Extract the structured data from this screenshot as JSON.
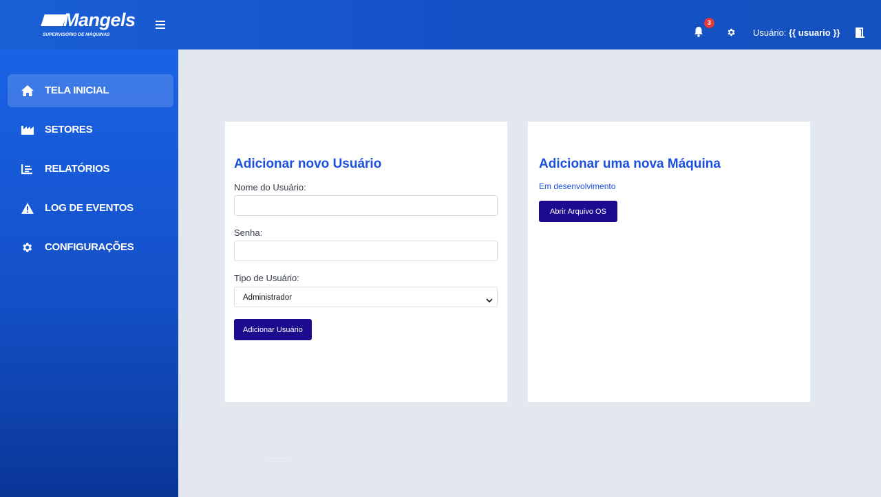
{
  "header": {
    "logo_text": "Mangels",
    "logo_subtitle": "SUPERVISÓRIO DE MÁQUINAS",
    "notification_count": "3",
    "user_prefix": "Usuário:",
    "user_name": "{{ usuario }}",
    "icons": [
      "menu-icon",
      "bell-icon",
      "gear-icon",
      "logout-door-icon"
    ]
  },
  "sidebar": {
    "items": [
      {
        "label": "TELA INICIAL",
        "icon": "home-icon",
        "active": true
      },
      {
        "label": "SETORES",
        "icon": "factory-icon",
        "active": false
      },
      {
        "label": "RELATÓRIOS",
        "icon": "chart-bars-icon",
        "active": false
      },
      {
        "label": "LOG DE EVENTOS",
        "icon": "warning-icon",
        "active": false
      },
      {
        "label": "CONFIGURAÇÕES",
        "icon": "gear-icon",
        "active": false
      }
    ]
  },
  "user_form": {
    "title": "Adicionar novo Usuário",
    "name_label": "Nome do Usuário:",
    "name_value": "",
    "password_label": "Senha:",
    "password_value": "",
    "type_label": "Tipo de Usuário:",
    "type_selected": "Administrador",
    "submit_label": "Adicionar Usuário"
  },
  "machine_form": {
    "title": "Adicionar uma nova Máquina",
    "status_text": "Em desenvolvimento",
    "open_button_label": "Abrir Arquivo OS"
  },
  "colors": {
    "topbar": "#1552c7",
    "sidebar_top": "#1a63e6",
    "sidebar_bottom": "#0a3797",
    "background": "#e3e7ee",
    "accent_title": "#1a4fe0",
    "button": "#1d0b8f",
    "badge": "#e53935"
  }
}
